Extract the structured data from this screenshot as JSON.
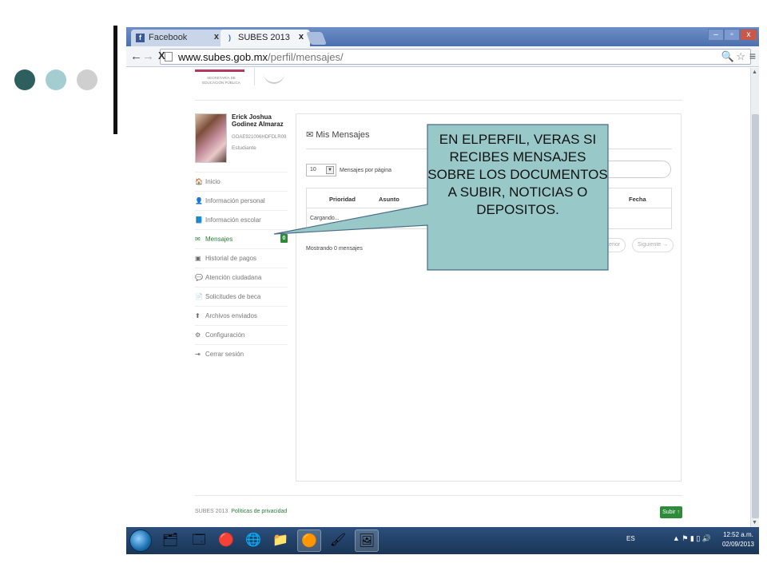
{
  "slide": {
    "decor": {
      "dot_colors": [
        "#2d5f5f",
        "#a3cdd1",
        "#cfcfcf"
      ],
      "bar_color": "#111111"
    }
  },
  "browser": {
    "tabs": [
      {
        "label": "Facebook",
        "icon": "facebook-icon",
        "close": "x"
      },
      {
        "label": "SUBES 2013",
        "icon": "loading-icon",
        "close": "x"
      }
    ],
    "window_controls": [
      "–",
      "▫",
      "x"
    ],
    "nav": {
      "back": "←",
      "forward": "→",
      "stop": "X"
    },
    "address": {
      "domain": "www.subes.gob.mx",
      "path": "/perfil/mensajes/"
    },
    "omnibox_icons": {
      "zoom": "🔍",
      "star": "☆"
    },
    "menu": "≡"
  },
  "header": {
    "sep_text": "SECRETARÍA DE EDUCACIÓN PÚBLICA"
  },
  "profile": {
    "name": "Erick Joshua Godinez Almaraz",
    "curp": "GOAE921006HDFDLR09",
    "role": "Estudiante"
  },
  "sidebar": {
    "items": [
      {
        "icon": "🏠",
        "label": "Inicio"
      },
      {
        "icon": "👤",
        "label": "Información personal"
      },
      {
        "icon": "📘",
        "label": "Información escolar"
      },
      {
        "icon": "✉",
        "label": "Mensajes",
        "badge": "0"
      },
      {
        "icon": "▣",
        "label": "Historial de pagos"
      },
      {
        "icon": "💬",
        "label": "Atención ciudadana"
      },
      {
        "icon": "📄",
        "label": "Solicitudes de beca"
      },
      {
        "icon": "⬆",
        "label": "Archivos enviados"
      },
      {
        "icon": "⚙",
        "label": "Configuración"
      },
      {
        "icon": "⇥",
        "label": "Cerrar sesión"
      }
    ]
  },
  "messages": {
    "title": "✉ Mis Mensajes",
    "page_length": "10",
    "page_length_arrow": "▼",
    "page_length_label": "Mensajes por página",
    "columns": [
      "Prioridad",
      "Asunto",
      "Fecha"
    ],
    "loading_row": "Cargando...",
    "info": "Mostrando 0 mensajes",
    "prev": "← Anterior",
    "next": "Siguiente →"
  },
  "footer": {
    "copyright": "SUBES 2013",
    "privacy_link": "Políticas de privacidad",
    "top_button": "Subir ↑"
  },
  "taskbar": {
    "apps": [
      "🗂",
      "🗔",
      "🔴",
      "🌐",
      "📁",
      "🟠",
      "🖌",
      "🖼"
    ],
    "tray": {
      "lang": "ES",
      "time": "12:52 a.m.",
      "date": "02/09/2013",
      "icons": "▲ ⚑ ▮ ▯ 🔊"
    }
  },
  "callout": {
    "text": "EN ELPERFIL, VERAS SI RECIBES MENSAJES SOBRE LOS DOCUMENTOS A SUBIR, NOTICIAS O DEPOSITOS.",
    "fill": "#99c8c8",
    "stroke": "#4a6b8a"
  }
}
